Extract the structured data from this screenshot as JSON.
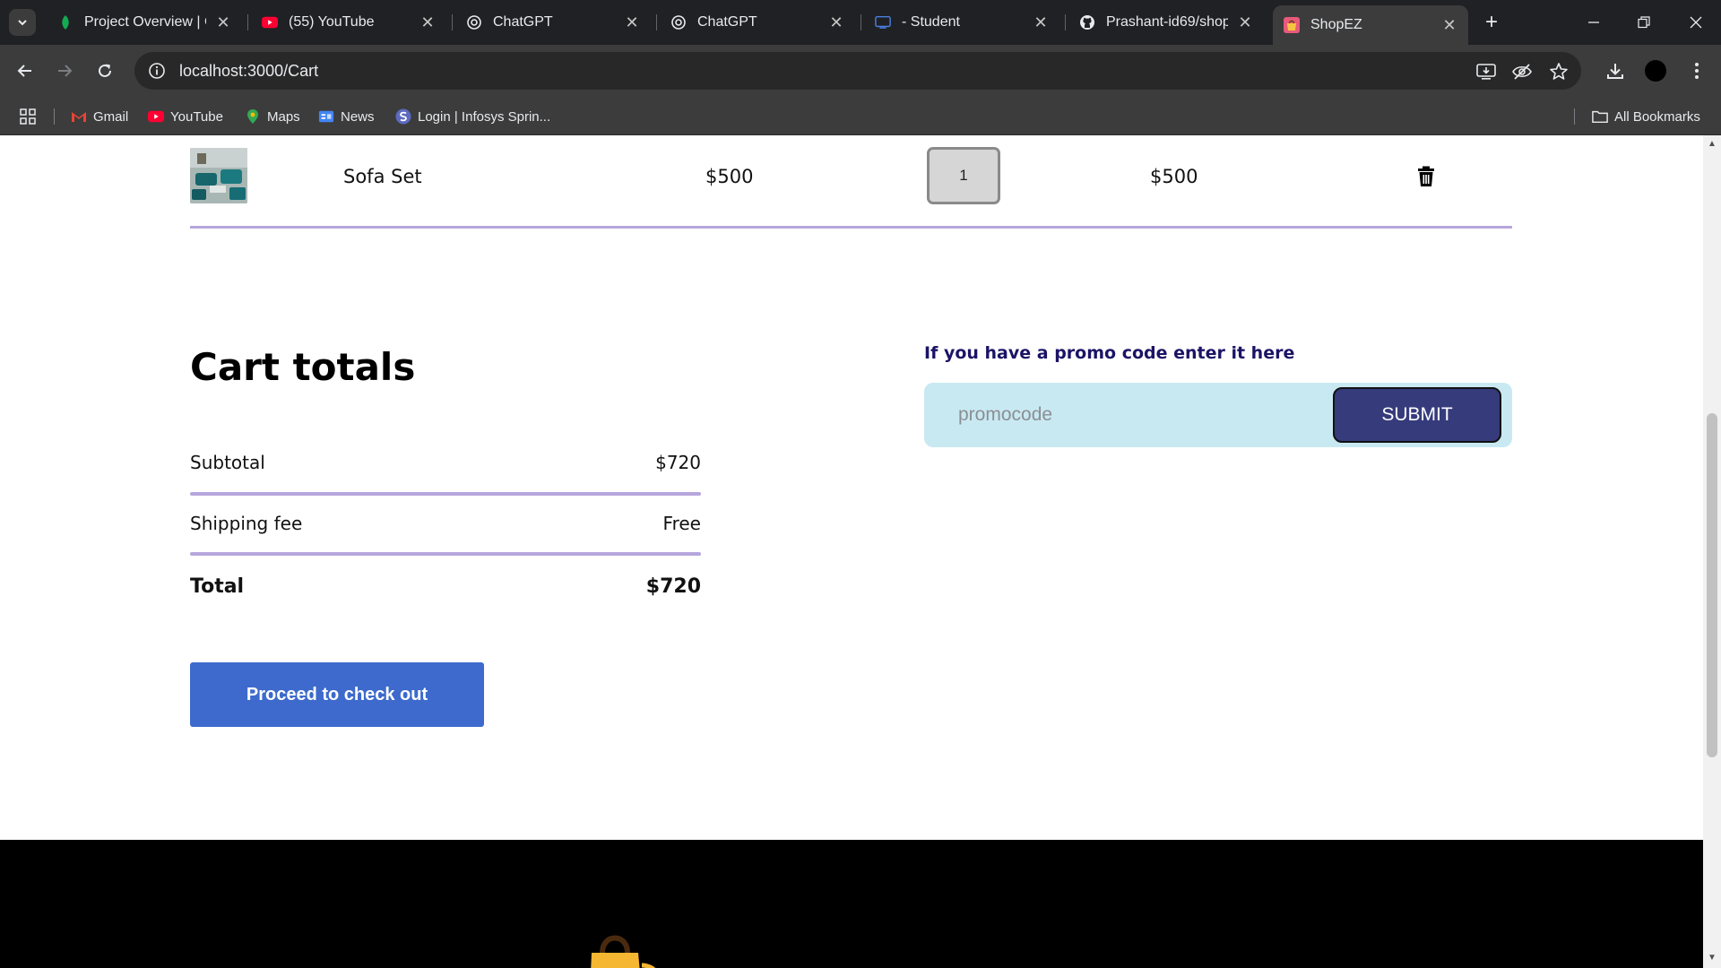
{
  "browser": {
    "tabs": [
      {
        "title": "Project Overview | Cl",
        "icon": "leaf-icon"
      },
      {
        "title": "(55) YouTube",
        "icon": "youtube-icon"
      },
      {
        "title": "ChatGPT",
        "icon": "openai-icon"
      },
      {
        "title": "ChatGPT",
        "icon": "openai-icon"
      },
      {
        "title": "- Student",
        "icon": "monitor-icon"
      },
      {
        "title": "Prashant-id69/shope",
        "icon": "github-icon"
      },
      {
        "title": "ShopEZ",
        "icon": "shopez-icon"
      }
    ],
    "url": "localhost:3000/Cart",
    "bookmarks": [
      "Gmail",
      "YouTube",
      "Maps",
      "News",
      "Login | Infosys Sprin..."
    ],
    "all_bookmarks": "All Bookmarks"
  },
  "cart": {
    "item": {
      "name": "Sofa Set",
      "price": "$500",
      "quantity": "1",
      "total": "$500"
    }
  },
  "totals": {
    "title": "Cart totals",
    "subtotal_label": "Subtotal",
    "subtotal_value": "$720",
    "shipping_label": "Shipping fee",
    "shipping_value": "Free",
    "total_label": "Total",
    "total_value": "$720",
    "checkout_label": "Proceed to check out"
  },
  "promo": {
    "label": "If you have a promo code enter it here",
    "placeholder": "promocode",
    "submit_label": "SUBMIT"
  },
  "colors": {
    "accent_line": "#b7a6dc",
    "checkout_button": "#3d6acc",
    "promo_background": "#c9e9f2",
    "submit_button": "#363b7c"
  }
}
